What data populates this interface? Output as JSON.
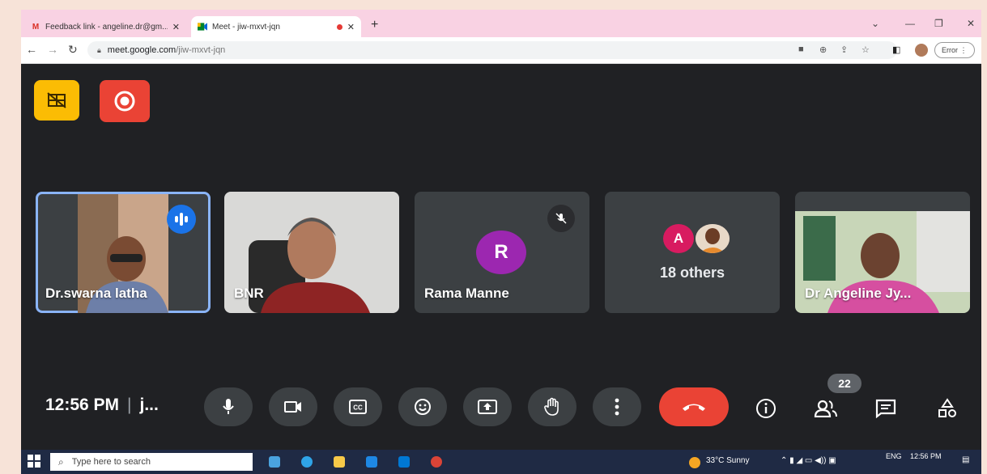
{
  "browser": {
    "tabs": [
      {
        "title": "Feedback link - angeline.dr@gm...",
        "icon": "gmail-icon"
      },
      {
        "title": "Meet - jiw-mxvt-jqn",
        "icon": "meet-icon",
        "recording": true
      }
    ],
    "new_tab": "+",
    "url_host": "meet.google.com",
    "url_path": "/jiw-mxvt-jqn",
    "error_label": "Error"
  },
  "meeting": {
    "participants": [
      {
        "name": "Dr.swarna latha",
        "speaking": true
      },
      {
        "name": "BNR"
      },
      {
        "name": "Rama Manne",
        "initial": "R",
        "muted": true
      },
      {
        "name": "18 others",
        "initial": "A"
      },
      {
        "name": "Dr Angeline Jy..."
      }
    ],
    "time": "12:56 PM",
    "separator": "|",
    "meeting_code": "j...",
    "participant_count": "22"
  },
  "colors": {
    "background": "#202124",
    "tile": "#3c4043",
    "active_border": "#8ab4f8",
    "end_call": "#ea4335",
    "record": "#ea4335",
    "layout_btn": "#fbbc04",
    "avatar_R": "#9c27b0",
    "avatar_A": "#d81b60"
  },
  "taskbar": {
    "search_placeholder": "Type here to search",
    "weather": "33°C  Sunny",
    "lang": "ENG",
    "time": "12:56 PM"
  }
}
